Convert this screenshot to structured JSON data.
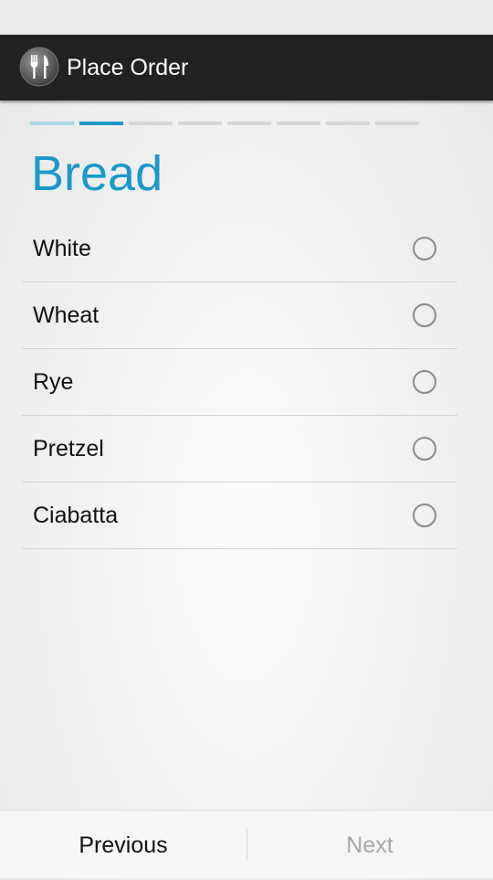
{
  "action_bar": {
    "title": "Place Order",
    "icon": "fork-knife-icon"
  },
  "progress": {
    "total_steps": 8,
    "current_step": 2
  },
  "page": {
    "title": "Bread"
  },
  "options": [
    {
      "label": "White",
      "selected": false
    },
    {
      "label": "Wheat",
      "selected": false
    },
    {
      "label": "Rye",
      "selected": false
    },
    {
      "label": "Pretzel",
      "selected": false
    },
    {
      "label": "Ciabatta",
      "selected": false
    }
  ],
  "nav": {
    "previous_label": "Previous",
    "next_label": "Next",
    "next_enabled": false
  },
  "colors": {
    "accent": "#1899cb",
    "progress_done": "#add8e6",
    "action_bar": "#222222"
  }
}
